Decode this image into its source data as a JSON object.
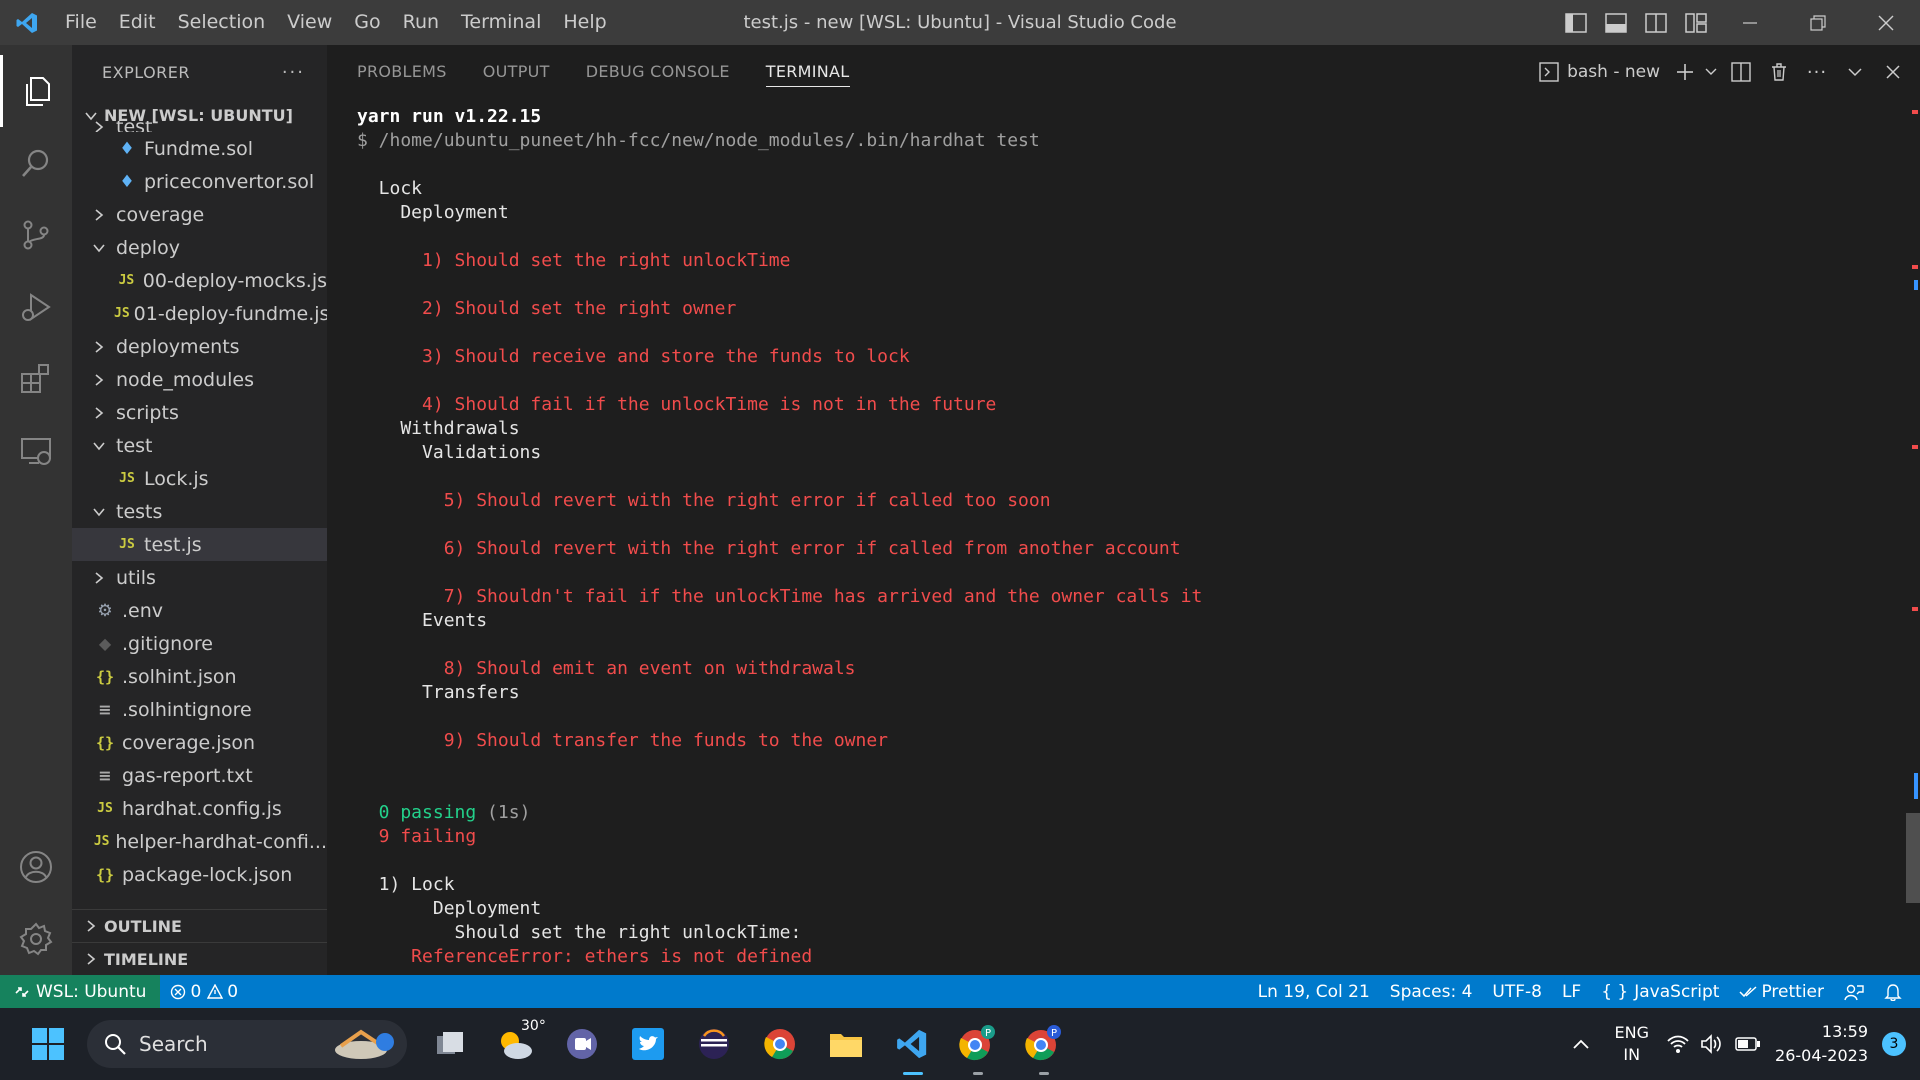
{
  "titlebar": {
    "menu": [
      "File",
      "Edit",
      "Selection",
      "View",
      "Go",
      "Run",
      "Terminal",
      "Help"
    ],
    "title": "test.js - new [WSL: Ubuntu] - Visual Studio Code"
  },
  "sidebar": {
    "title": "EXPLORER",
    "root": "NEW [WSL: UBUNTU]",
    "items": [
      {
        "label": "test",
        "type": "folder-partial",
        "depth": 1
      },
      {
        "label": "Fundme.sol",
        "type": "sol",
        "depth": 2
      },
      {
        "label": "priceconvertor.sol",
        "type": "sol",
        "depth": 2
      },
      {
        "label": "coverage",
        "type": "folder",
        "depth": 1
      },
      {
        "label": "deploy",
        "type": "folder-open",
        "depth": 1
      },
      {
        "label": "00-deploy-mocks.js",
        "type": "js",
        "depth": 2
      },
      {
        "label": "01-deploy-fundme.js",
        "type": "js",
        "depth": 2
      },
      {
        "label": "deployments",
        "type": "folder",
        "depth": 1
      },
      {
        "label": "node_modules",
        "type": "folder",
        "depth": 1
      },
      {
        "label": "scripts",
        "type": "folder",
        "depth": 1
      },
      {
        "label": "test",
        "type": "folder-open",
        "depth": 1
      },
      {
        "label": "Lock.js",
        "type": "js",
        "depth": 2
      },
      {
        "label": "tests",
        "type": "folder-open",
        "depth": 1
      },
      {
        "label": "test.js",
        "type": "js",
        "depth": 2,
        "selected": true
      },
      {
        "label": "utils",
        "type": "folder",
        "depth": 1
      },
      {
        "label": ".env",
        "type": "gear",
        "depth": 1
      },
      {
        "label": ".gitignore",
        "type": "git",
        "depth": 1
      },
      {
        "label": ".solhint.json",
        "type": "json",
        "depth": 1
      },
      {
        "label": ".solhintignore",
        "type": "txt",
        "depth": 1
      },
      {
        "label": "coverage.json",
        "type": "json",
        "depth": 1
      },
      {
        "label": "gas-report.txt",
        "type": "txt",
        "depth": 1
      },
      {
        "label": "hardhat.config.js",
        "type": "js",
        "depth": 1
      },
      {
        "label": "helper-hardhat-confi...",
        "type": "js",
        "depth": 1
      },
      {
        "label": "package-lock.json",
        "type": "json",
        "depth": 1
      }
    ],
    "outline": "OUTLINE",
    "timeline": "TIMELINE"
  },
  "panel": {
    "tabs": [
      "PROBLEMS",
      "OUTPUT",
      "DEBUG CONSOLE",
      "TERMINAL"
    ],
    "active_tab": "TERMINAL",
    "shell_label": "bash - new"
  },
  "terminal": {
    "lines": [
      {
        "text": "yarn run v1.22.15",
        "style": "bold"
      },
      {
        "text": "$ /home/ubuntu_puneet/hh-fcc/new/node_modules/.bin/hardhat test",
        "style": "gray"
      },
      {
        "text": "",
        "style": "white"
      },
      {
        "text": "  Lock",
        "style": "white"
      },
      {
        "text": "    Deployment",
        "style": "white"
      },
      {
        "text": "",
        "style": "white"
      },
      {
        "text": "      1) Should set the right unlockTime",
        "style": "red"
      },
      {
        "text": "",
        "style": "white"
      },
      {
        "text": "      2) Should set the right owner",
        "style": "red"
      },
      {
        "text": "",
        "style": "white"
      },
      {
        "text": "      3) Should receive and store the funds to lock",
        "style": "red"
      },
      {
        "text": "",
        "style": "white"
      },
      {
        "text": "      4) Should fail if the unlockTime is not in the future",
        "style": "red"
      },
      {
        "text": "    Withdrawals",
        "style": "white"
      },
      {
        "text": "      Validations",
        "style": "white"
      },
      {
        "text": "",
        "style": "white"
      },
      {
        "text": "        5) Should revert with the right error if called too soon",
        "style": "red"
      },
      {
        "text": "",
        "style": "white"
      },
      {
        "text": "        6) Should revert with the right error if called from another account",
        "style": "red"
      },
      {
        "text": "",
        "style": "white"
      },
      {
        "text": "        7) Shouldn't fail if the unlockTime has arrived and the owner calls it",
        "style": "red"
      },
      {
        "text": "      Events",
        "style": "white"
      },
      {
        "text": "",
        "style": "white"
      },
      {
        "text": "        8) Should emit an event on withdrawals",
        "style": "red"
      },
      {
        "text": "      Transfers",
        "style": "white"
      },
      {
        "text": "",
        "style": "white"
      },
      {
        "text": "        9) Should transfer the funds to the owner",
        "style": "red"
      },
      {
        "text": "",
        "style": "white"
      },
      {
        "text": "",
        "style": "white"
      },
      {
        "text": "  0 passing",
        "style": "green",
        "suffix": " (1s)"
      },
      {
        "text": "  9 failing",
        "style": "red"
      },
      {
        "text": "",
        "style": "white"
      },
      {
        "text": "  1) Lock",
        "style": "white"
      },
      {
        "text": "       Deployment",
        "style": "white"
      },
      {
        "text": "         Should set the right unlockTime:",
        "style": "white"
      },
      {
        "text": "     ReferenceError: ethers is not defined",
        "style": "red"
      }
    ]
  },
  "statusbar": {
    "remote": "WSL: Ubuntu",
    "errors": "0",
    "warnings": "0",
    "position": "Ln 19, Col 21",
    "spaces": "Spaces: 4",
    "encoding": "UTF-8",
    "eol": "LF",
    "language": "JavaScript",
    "formatter": "Prettier"
  },
  "taskbar": {
    "search_label": "Search",
    "weather": "30°",
    "lang_line1": "ENG",
    "lang_line2": "IN",
    "time": "13:59",
    "date": "26-04-2023",
    "notifications": "3"
  }
}
